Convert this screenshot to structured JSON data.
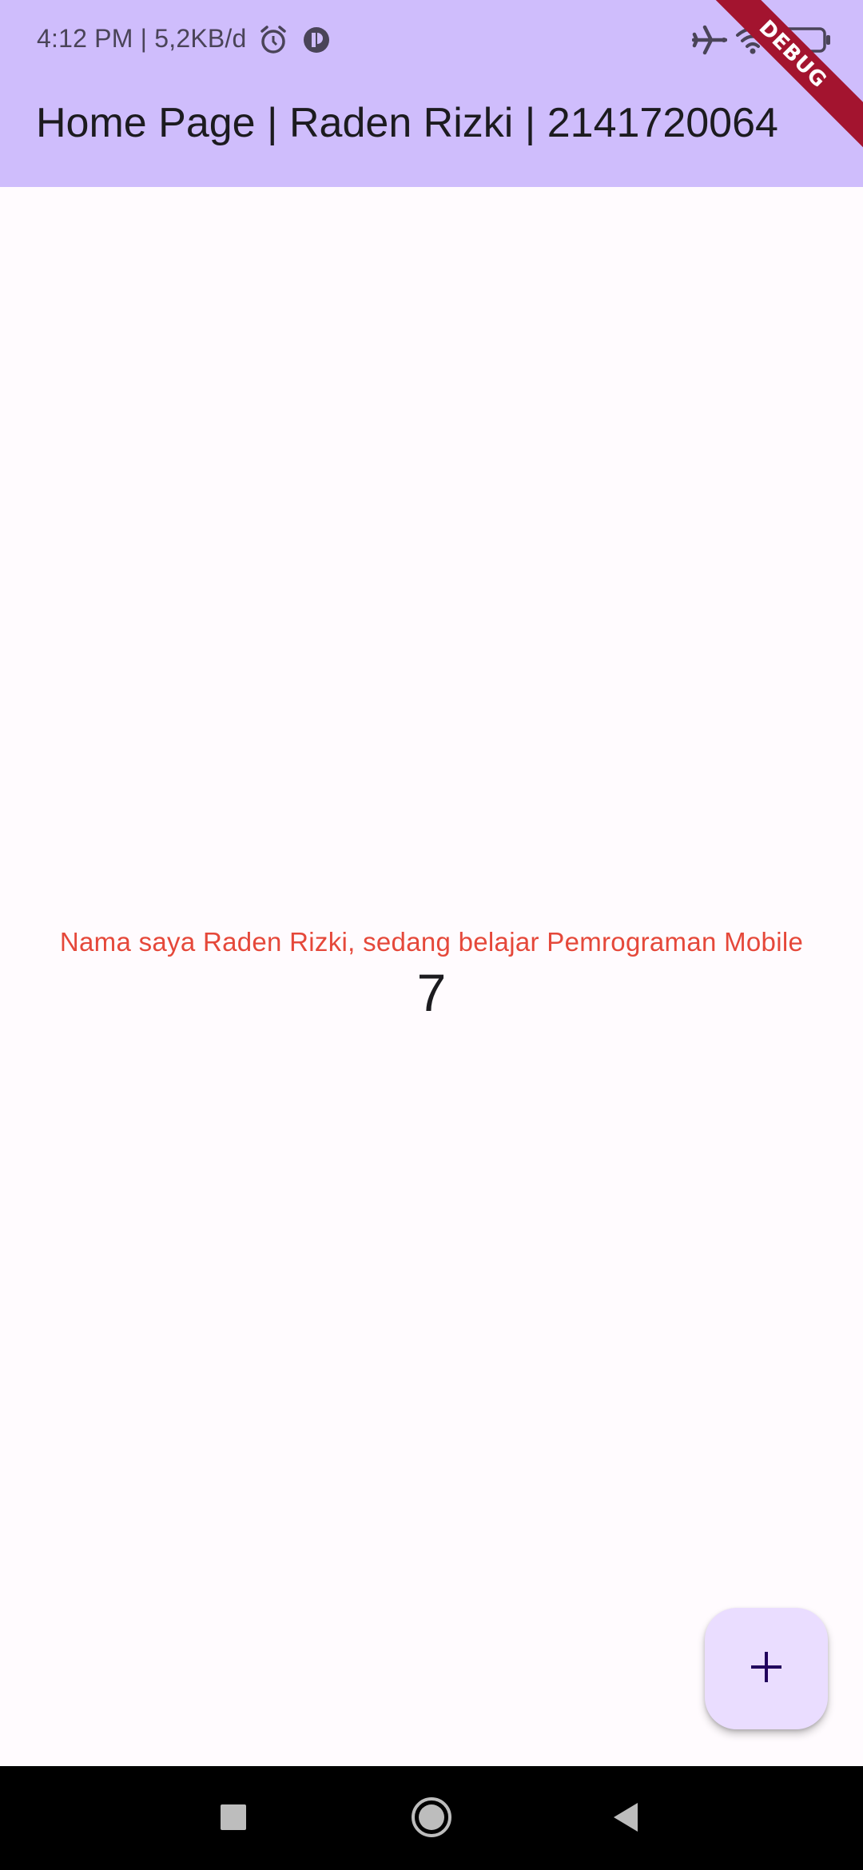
{
  "status_bar": {
    "time_text": "4:12 PM | 5,2KB/d",
    "icons": [
      "alarm-icon",
      "app-notification-icon",
      "airplane-mode-icon",
      "wifi-icon",
      "battery-icon"
    ]
  },
  "app_bar": {
    "title": "Home Page | Raden Rizki | 2141720064"
  },
  "debug_banner": {
    "label": "DEBUG"
  },
  "main": {
    "message": "Nama saya Raden Rizki, sedang belajar Pemrograman Mobile",
    "counter": "7"
  },
  "fab": {
    "icon": "add-icon"
  },
  "navigation_bar": {
    "buttons": [
      "recents-button",
      "home-button",
      "back-button"
    ]
  },
  "colors": {
    "app_bar": "#cfbdfc",
    "background": "#fffbfe",
    "message_text": "#e5483a",
    "fab_background": "#eaddff",
    "fab_icon": "#21005d",
    "debug_banner": "#a3142f"
  }
}
